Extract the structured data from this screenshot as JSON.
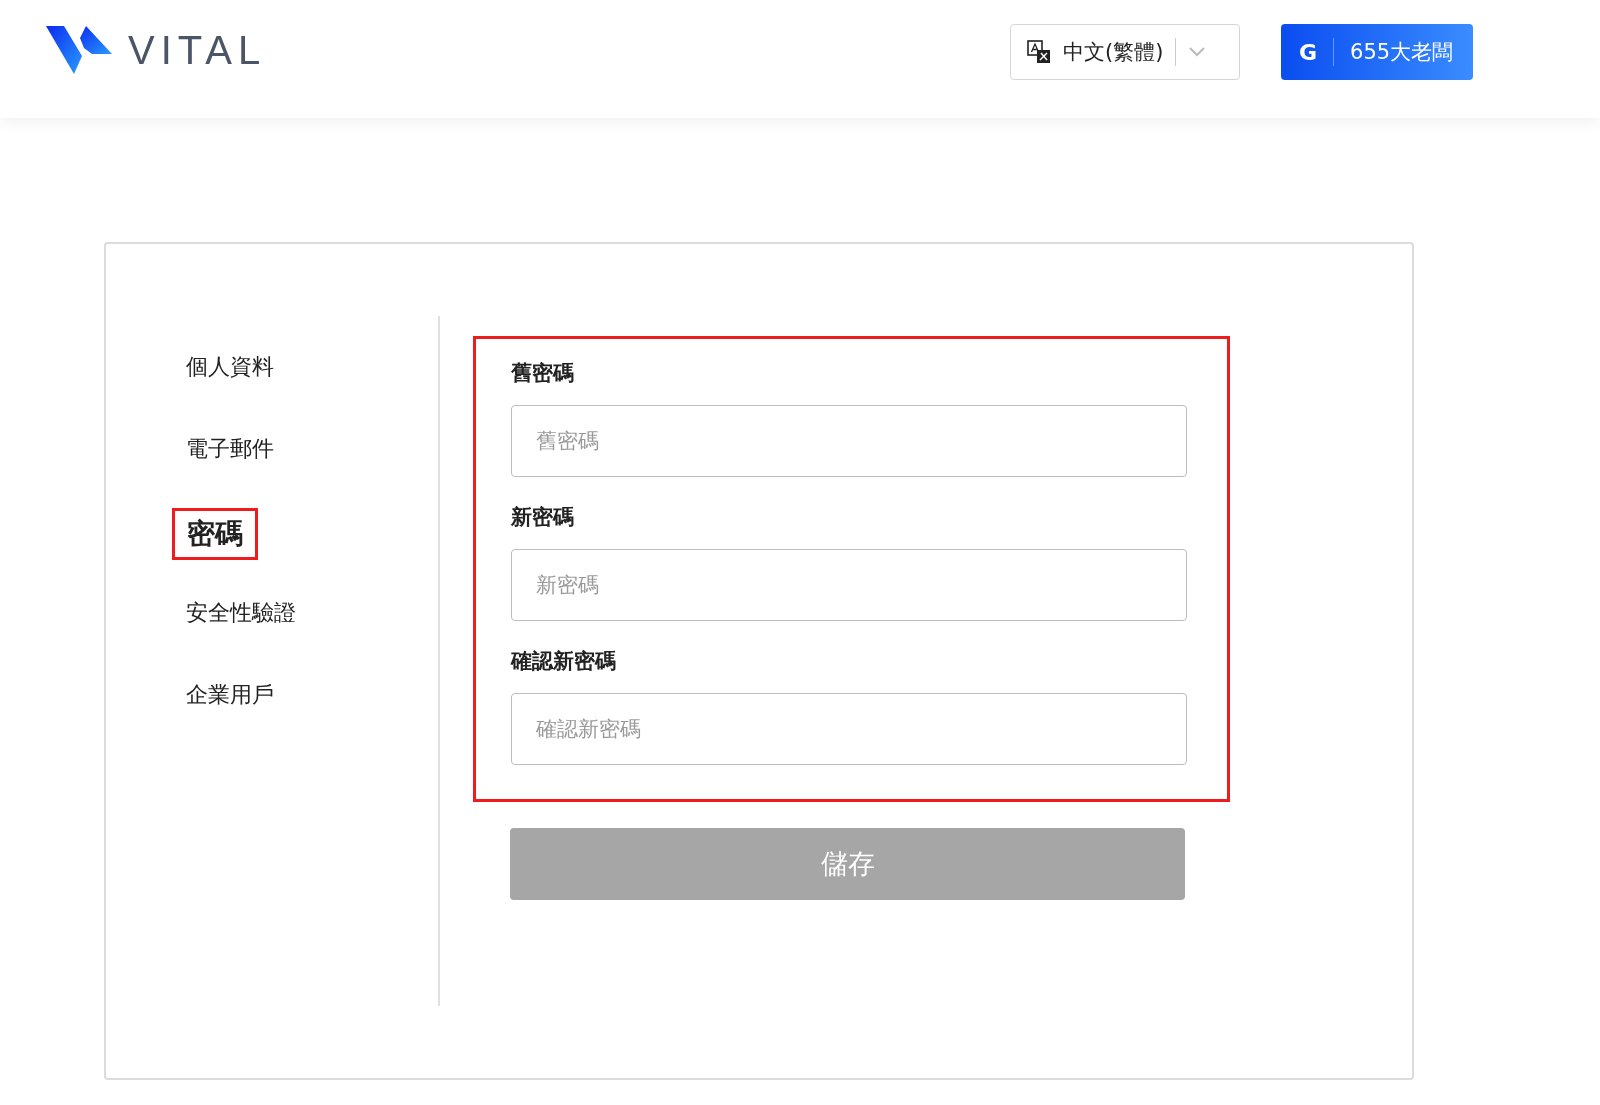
{
  "header": {
    "logo_text": "VITAL",
    "language": {
      "label": "中文(繁體)"
    },
    "account": {
      "initial": "G",
      "name": "655大老闆"
    }
  },
  "sidebar": {
    "items": [
      {
        "label": "個人資料",
        "selected": false
      },
      {
        "label": "電子郵件",
        "selected": false
      },
      {
        "label": "密碼",
        "selected": true
      },
      {
        "label": "安全性驗證",
        "selected": false
      },
      {
        "label": "企業用戶",
        "selected": false
      }
    ]
  },
  "form": {
    "highlighted": true,
    "fields": [
      {
        "label": "舊密碼",
        "placeholder": "舊密碼"
      },
      {
        "label": "新密碼",
        "placeholder": "新密碼"
      },
      {
        "label": "確認新密碼",
        "placeholder": "確認新密碼"
      }
    ],
    "save_button": {
      "label": "儲存",
      "disabled": true
    }
  }
}
